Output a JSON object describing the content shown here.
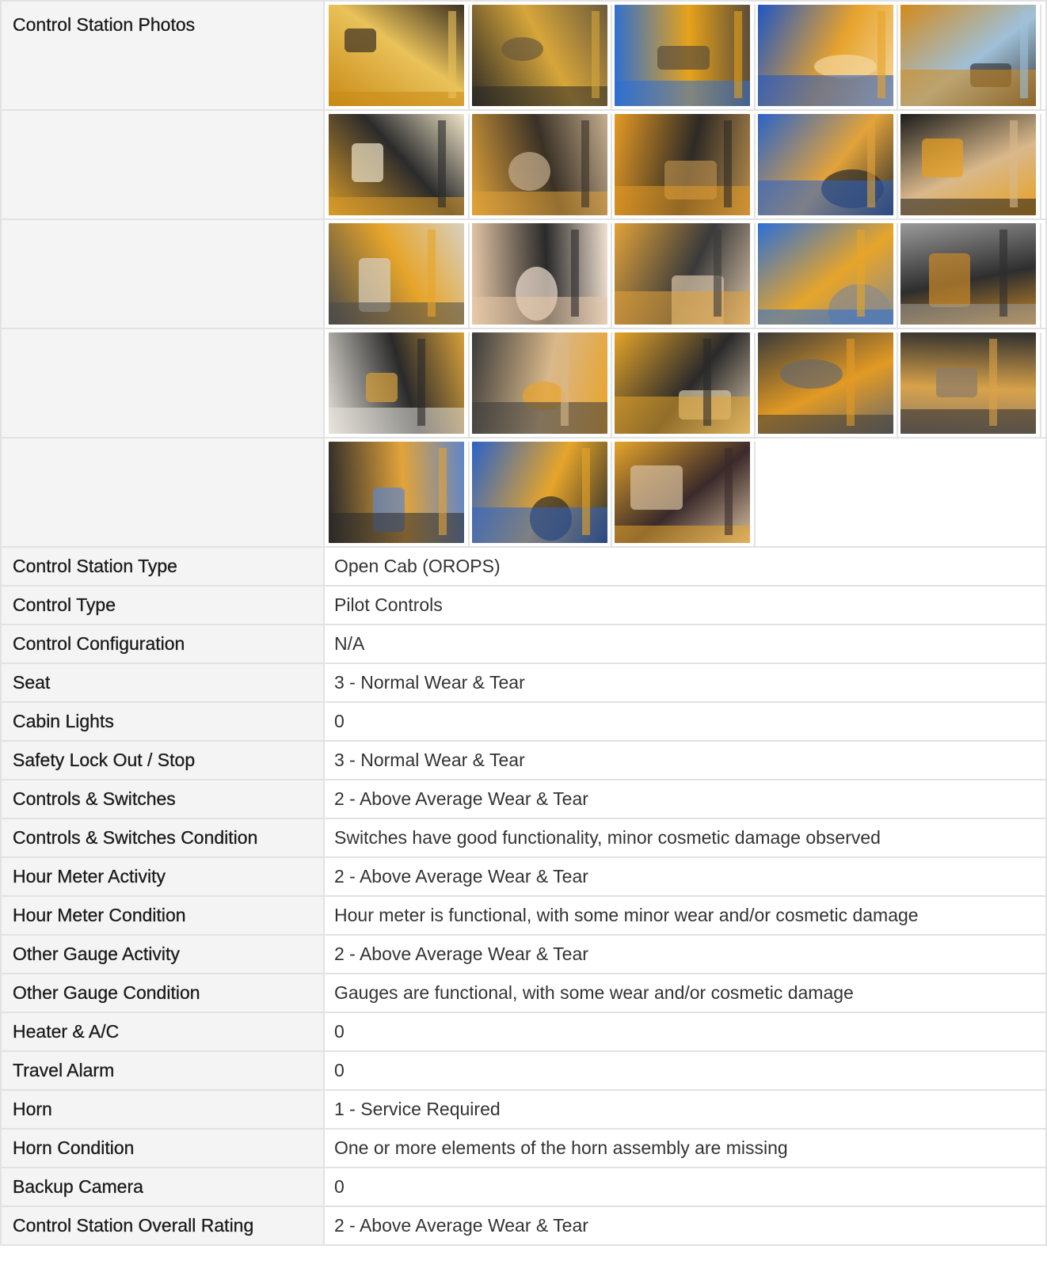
{
  "photos_section": {
    "label": "Control Station Photos",
    "rows": [
      [
        {
          "icon": "footwell-photo",
          "colors": [
            "#c98a16",
            "#e9c25a",
            "#3b2f22"
          ]
        },
        {
          "icon": "floor-mat-photo",
          "colors": [
            "#2c2a26",
            "#d7a63a",
            "#6b5a3c"
          ]
        },
        {
          "icon": "cab-roof-photo",
          "colors": [
            "#2f6fd1",
            "#e6a21a",
            "#5b4d3a"
          ]
        },
        {
          "icon": "roof-guard-photo",
          "colors": [
            "#1f56c4",
            "#e8a32c",
            "#f2d7a0"
          ]
        },
        {
          "icon": "windshield-photo",
          "colors": [
            "#d28a1b",
            "#9fc0d8",
            "#3a3a3a"
          ]
        }
      ],
      [
        {
          "icon": "cab-interior-photo",
          "colors": [
            "#d89a2a",
            "#2b2b2b",
            "#f0e4c8"
          ]
        },
        {
          "icon": "pedal-photo",
          "colors": [
            "#e0a23a",
            "#3a3126",
            "#c4ae8e"
          ]
        },
        {
          "icon": "side-panel-photo",
          "colors": [
            "#e59a24",
            "#2e2a25",
            "#b48a4a"
          ]
        },
        {
          "icon": "steering-view-photo",
          "colors": [
            "#2a63c8",
            "#e2a33a",
            "#2b2b2b"
          ]
        },
        {
          "icon": "steering-wheel-photo",
          "colors": [
            "#1c1c1c",
            "#d9b88a",
            "#e8a020"
          ]
        }
      ],
      [
        {
          "icon": "ignition-key-photo",
          "colors": [
            "#4a4a4a",
            "#e6a52a",
            "#d8d0c0"
          ]
        },
        {
          "icon": "joystick-base-photo",
          "colors": [
            "#e8c9a8",
            "#2a2a2a",
            "#f0e0d0"
          ]
        },
        {
          "icon": "joystick-photo",
          "colors": [
            "#e2a33a",
            "#3a3a3a",
            "#d9c3a6"
          ]
        },
        {
          "icon": "warning-decal-photo",
          "colors": [
            "#2c6fd6",
            "#e6a52a",
            "#8a8a8a"
          ]
        },
        {
          "icon": "control-panel-photo",
          "colors": [
            "#9a9a9a",
            "#2e2e2e",
            "#c98a2a"
          ]
        }
      ],
      [
        {
          "icon": "warning-label-photo",
          "colors": [
            "#e8e4dc",
            "#2a2a2a",
            "#d7a03a"
          ]
        },
        {
          "icon": "lever-photo",
          "colors": [
            "#3a3a3a",
            "#d9b88a",
            "#e8a32c"
          ]
        },
        {
          "icon": "gauge-cluster-photo",
          "colors": [
            "#e6a52a",
            "#2a2a2a",
            "#d8c6a8"
          ]
        },
        {
          "icon": "seat-photo",
          "colors": [
            "#3a3a3a",
            "#e29a24",
            "#6a6a6a"
          ]
        },
        {
          "icon": "seat-cushion-photo",
          "colors": [
            "#2e2e2e",
            "#d8a24a",
            "#8a7a6a"
          ]
        }
      ],
      [
        {
          "icon": "seat-side-photo",
          "colors": [
            "#2a2a2a",
            "#e2a33a",
            "#5f86c8"
          ]
        },
        {
          "icon": "cab-exterior-photo",
          "colors": [
            "#2a62c8",
            "#e6a52a",
            "#2b2b2b"
          ]
        },
        {
          "icon": "shift-boot-photo",
          "colors": [
            "#e6a52a",
            "#3a2a2a",
            "#d8c0a0"
          ]
        }
      ]
    ]
  },
  "rows": [
    {
      "label": "Control Station Type",
      "value": "Open Cab (OROPS)"
    },
    {
      "label": "Control Type",
      "value": "Pilot Controls"
    },
    {
      "label": "Control Configuration",
      "value": "N/A"
    },
    {
      "label": "Seat",
      "value": "3 - Normal Wear & Tear"
    },
    {
      "label": "Cabin Lights",
      "value": "0"
    },
    {
      "label": "Safety Lock Out / Stop",
      "value": "3 - Normal Wear & Tear"
    },
    {
      "label": "Controls & Switches",
      "value": "2 - Above Average Wear & Tear"
    },
    {
      "label": "Controls & Switches Condition",
      "value": "Switches have good functionality, minor cosmetic damage observed"
    },
    {
      "label": "Hour Meter Activity",
      "value": "2 - Above Average Wear & Tear"
    },
    {
      "label": "Hour Meter Condition",
      "value": "Hour meter is functional, with some minor wear and/or cosmetic damage"
    },
    {
      "label": "Other Gauge Activity",
      "value": "2 - Above Average Wear & Tear"
    },
    {
      "label": "Other Gauge Condition",
      "value": "Gauges are functional, with some wear and/or cosmetic damage"
    },
    {
      "label": "Heater & A/C",
      "value": "0"
    },
    {
      "label": "Travel Alarm",
      "value": "0"
    },
    {
      "label": "Horn",
      "value": "1 - Service Required"
    },
    {
      "label": "Horn Condition",
      "value": "One or more elements of the horn assembly are missing"
    },
    {
      "label": "Backup Camera",
      "value": "0"
    },
    {
      "label": "Control Station Overall Rating",
      "value": "2 - Above Average Wear & Tear"
    }
  ]
}
